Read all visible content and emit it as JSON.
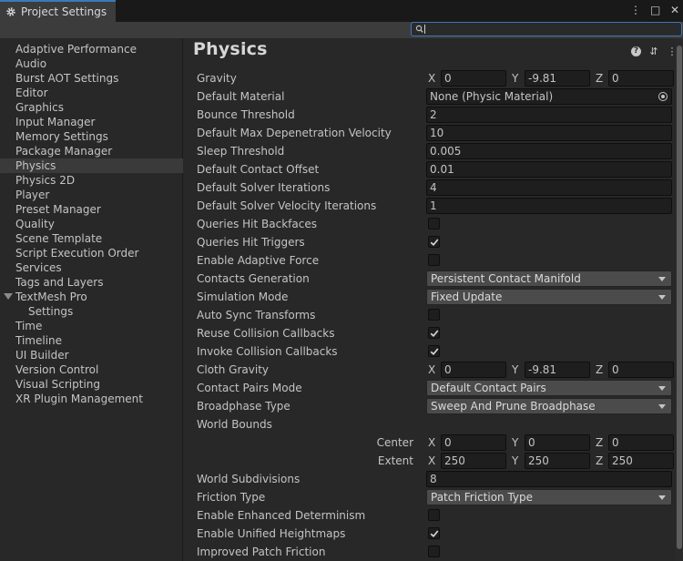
{
  "window": {
    "tab_title": "Project Settings",
    "icons": [
      "more-vert-icon",
      "maximize-icon",
      "close-icon"
    ]
  },
  "search": {
    "placeholder": "",
    "value": ""
  },
  "sidebar": {
    "items": [
      {
        "label": "Adaptive Performance"
      },
      {
        "label": "Audio"
      },
      {
        "label": "Burst AOT Settings"
      },
      {
        "label": "Editor"
      },
      {
        "label": "Graphics"
      },
      {
        "label": "Input Manager"
      },
      {
        "label": "Memory Settings"
      },
      {
        "label": "Package Manager"
      },
      {
        "label": "Physics",
        "selected": true
      },
      {
        "label": "Physics 2D"
      },
      {
        "label": "Player"
      },
      {
        "label": "Preset Manager"
      },
      {
        "label": "Quality"
      },
      {
        "label": "Scene Template"
      },
      {
        "label": "Script Execution Order"
      },
      {
        "label": "Services"
      },
      {
        "label": "Tags and Layers"
      },
      {
        "label": "TextMesh Pro",
        "expanded": true
      },
      {
        "label": "Settings",
        "child": true
      },
      {
        "label": "Time"
      },
      {
        "label": "Timeline"
      },
      {
        "label": "UI Builder"
      },
      {
        "label": "Version Control"
      },
      {
        "label": "Visual Scripting"
      },
      {
        "label": "XR Plugin Management"
      }
    ]
  },
  "main": {
    "title": "Physics",
    "header_icons": [
      "help-icon",
      "presets-icon",
      "more-vert-icon"
    ],
    "rows": [
      {
        "label": "Gravity",
        "type": "vec3",
        "x": "0",
        "y": "-9.81",
        "z": "0"
      },
      {
        "label": "Default Material",
        "type": "object",
        "value": "None (Physic Material)"
      },
      {
        "label": "Bounce Threshold",
        "type": "text",
        "value": "2"
      },
      {
        "label": "Default Max Depenetration Velocity",
        "type": "text",
        "value": "10"
      },
      {
        "label": "Sleep Threshold",
        "type": "text",
        "value": "0.005"
      },
      {
        "label": "Default Contact Offset",
        "type": "text",
        "value": "0.01"
      },
      {
        "label": "Default Solver Iterations",
        "type": "text",
        "value": "4"
      },
      {
        "label": "Default Solver Velocity Iterations",
        "type": "text",
        "value": "1"
      },
      {
        "label": "Queries Hit Backfaces",
        "type": "check",
        "checked": false
      },
      {
        "label": "Queries Hit Triggers",
        "type": "check",
        "checked": true
      },
      {
        "label": "Enable Adaptive Force",
        "type": "check",
        "checked": false
      },
      {
        "label": "Contacts Generation",
        "type": "dropdown",
        "value": "Persistent Contact Manifold"
      },
      {
        "label": "Simulation Mode",
        "type": "dropdown",
        "value": "Fixed Update"
      },
      {
        "label": "Auto Sync Transforms",
        "type": "check",
        "checked": false
      },
      {
        "label": "Reuse Collision Callbacks",
        "type": "check",
        "checked": true
      },
      {
        "label": "Invoke Collision Callbacks",
        "type": "check",
        "checked": true
      },
      {
        "label": "Cloth Gravity",
        "type": "vec3",
        "x": "0",
        "y": "-9.81",
        "z": "0"
      },
      {
        "label": "Contact Pairs Mode",
        "type": "dropdown",
        "value": "Default Contact Pairs"
      },
      {
        "label": "Broadphase Type",
        "type": "dropdown",
        "value": "Sweep And Prune Broadphase"
      },
      {
        "label": "World Bounds",
        "type": "header"
      },
      {
        "label": "Center",
        "type": "vec3",
        "indent": true,
        "x": "0",
        "y": "0",
        "z": "0"
      },
      {
        "label": "Extent",
        "type": "vec3",
        "indent": true,
        "x": "250",
        "y": "250",
        "z": "250"
      },
      {
        "label": "World Subdivisions",
        "type": "text",
        "value": "8"
      },
      {
        "label": "Friction Type",
        "type": "dropdown",
        "value": "Patch Friction Type"
      },
      {
        "label": "Enable Enhanced Determinism",
        "type": "check",
        "checked": false
      },
      {
        "label": "Enable Unified Heightmaps",
        "type": "check",
        "checked": true
      },
      {
        "label": "Improved Patch Friction",
        "type": "check",
        "checked": false
      }
    ],
    "axis_labels": {
      "x": "X",
      "y": "Y",
      "z": "Z"
    }
  }
}
